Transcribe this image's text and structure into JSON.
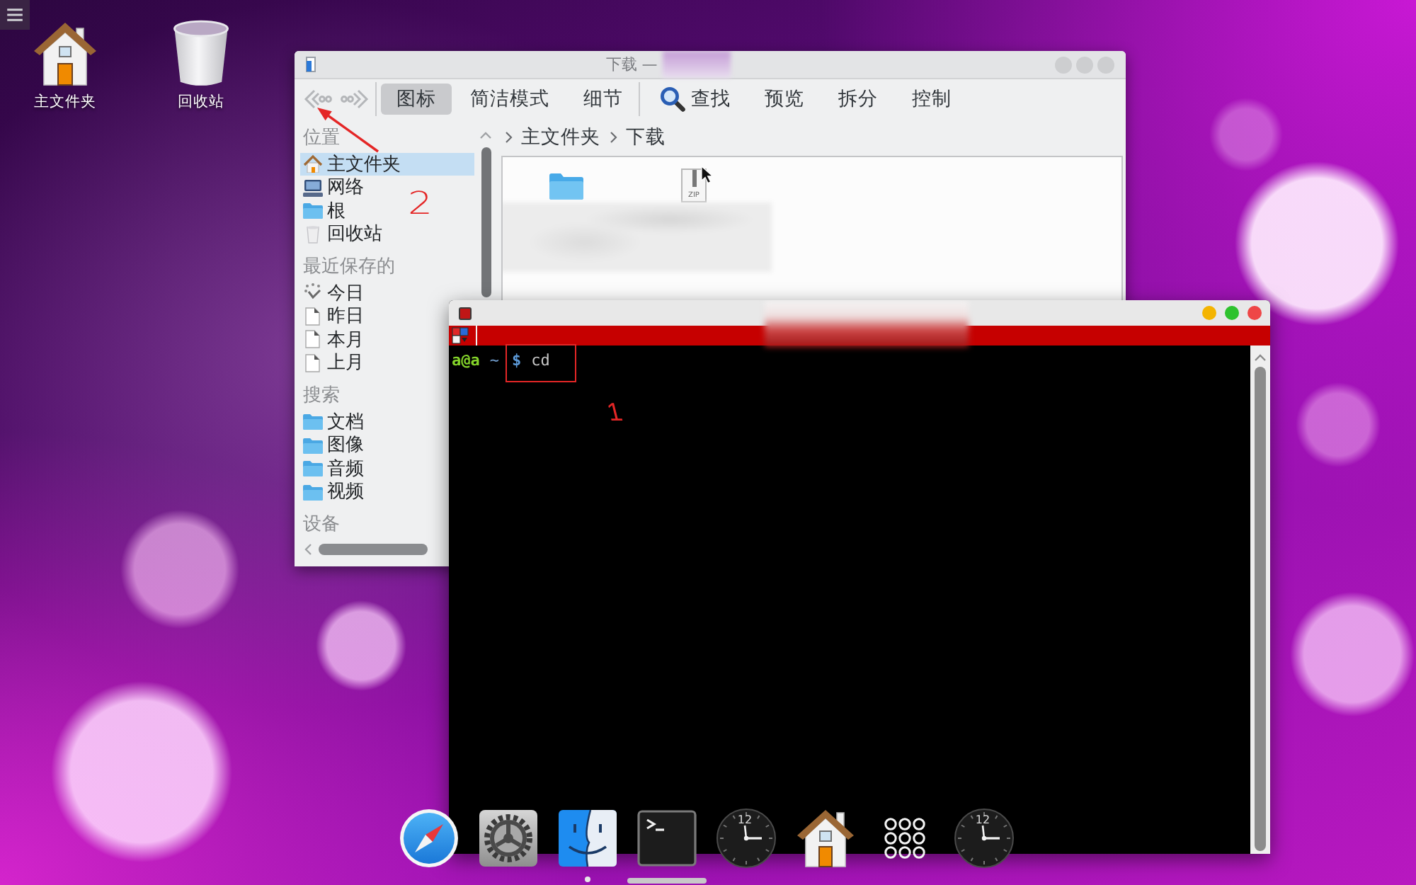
{
  "desktop_icons": [
    {
      "kind": "home",
      "label": "主文件夹"
    },
    {
      "kind": "trash",
      "label": "回收站"
    }
  ],
  "file_manager": {
    "title": "下载 —",
    "toolbar": {
      "view_modes": [
        {
          "label": "图标",
          "selected": true
        },
        {
          "label": "简洁模式",
          "selected": false
        },
        {
          "label": "细节",
          "selected": false
        }
      ],
      "actions": [
        {
          "kind": "search",
          "label": "查找"
        },
        {
          "kind": "text",
          "label": "预览"
        },
        {
          "kind": "text",
          "label": "拆分"
        },
        {
          "kind": "text",
          "label": "控制"
        }
      ]
    },
    "sidebar": {
      "sections": [
        {
          "heading": "位置",
          "items": [
            {
              "kind": "home",
              "label": "主文件夹",
              "selected": true
            },
            {
              "kind": "network",
              "label": "网络",
              "selected": false
            },
            {
              "kind": "folder",
              "label": "根",
              "selected": false
            },
            {
              "kind": "trash",
              "label": "回收站",
              "selected": false
            }
          ]
        },
        {
          "heading": "最近保存的",
          "items": [
            {
              "kind": "recent",
              "label": "今日",
              "selected": false
            },
            {
              "kind": "document",
              "label": "昨日",
              "selected": false
            },
            {
              "kind": "document",
              "label": "本月",
              "selected": false
            },
            {
              "kind": "document",
              "label": "上月",
              "selected": false
            }
          ]
        },
        {
          "heading": "搜索",
          "items": [
            {
              "kind": "folder",
              "label": "文档",
              "selected": false
            },
            {
              "kind": "folder",
              "label": "图像",
              "selected": false
            },
            {
              "kind": "folder",
              "label": "音频",
              "selected": false
            },
            {
              "kind": "folder",
              "label": "视频",
              "selected": false
            }
          ]
        },
        {
          "heading": "设备"
        }
      ]
    },
    "breadcrumb": [
      "主文件夹",
      "下载"
    ],
    "files": [
      {
        "kind": "folder"
      },
      {
        "kind": "archive",
        "badge": "ZIP"
      }
    ]
  },
  "terminal": {
    "prompt": {
      "user": "a@a",
      "path": "~",
      "symbol": "$",
      "command": "cd"
    }
  },
  "dock": {
    "items": [
      {
        "kind": "compass",
        "running": false,
        "active": false
      },
      {
        "kind": "gear",
        "running": false,
        "active": false
      },
      {
        "kind": "face",
        "running": true,
        "active": false
      },
      {
        "kind": "terminal",
        "running": false,
        "active": true
      },
      {
        "kind": "clock",
        "numeral": "12",
        "running": false,
        "active": false
      },
      {
        "kind": "home",
        "running": false,
        "active": false
      },
      {
        "kind": "grid",
        "running": false,
        "active": false
      },
      {
        "kind": "clock",
        "numeral": "12",
        "running": false,
        "active": false
      }
    ]
  },
  "annotations": [
    {
      "kind": "arrow"
    },
    {
      "kind": "number",
      "text": "2"
    },
    {
      "kind": "box"
    },
    {
      "kind": "number",
      "text": "1"
    }
  ]
}
